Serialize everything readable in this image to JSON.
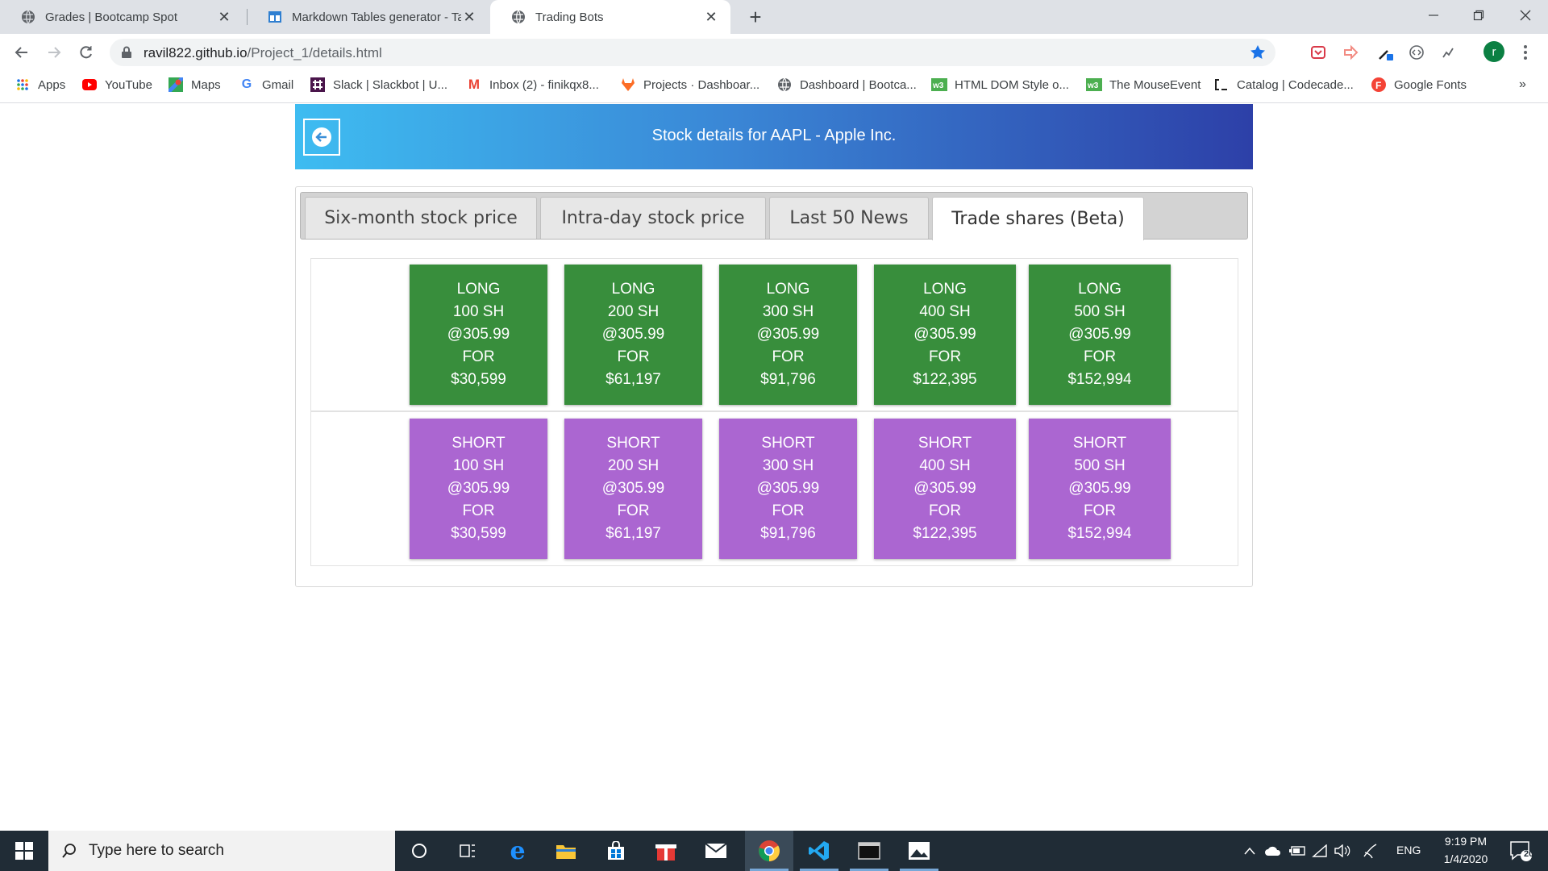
{
  "browser": {
    "tabs": [
      {
        "title": "Grades | Bootcamp Spot",
        "icon": "globe-icon",
        "active": false
      },
      {
        "title": "Markdown Tables generator - Tab",
        "icon": "tables-generator-icon",
        "active": false
      },
      {
        "title": "Trading Bots",
        "icon": "globe-icon",
        "active": true
      }
    ],
    "url_domain": "ravil822.github.io",
    "url_path": "/Project_1/details.html",
    "profile_initial": "r"
  },
  "bookmarks": [
    {
      "label": "Apps",
      "icon": "apps-grid-icon"
    },
    {
      "label": "YouTube",
      "icon": "youtube-icon"
    },
    {
      "label": "Maps",
      "icon": "maps-icon"
    },
    {
      "label": "Gmail",
      "icon": "google-icon"
    },
    {
      "label": "Slack | Slackbot | U...",
      "icon": "slack-icon"
    },
    {
      "label": "Inbox (2) - finikqx8...",
      "icon": "gmail-icon"
    },
    {
      "label": "Projects · Dashboar...",
      "icon": "gitlab-icon"
    },
    {
      "label": "Dashboard | Bootca...",
      "icon": "globe-icon"
    },
    {
      "label": "HTML DOM Style o...",
      "icon": "w3schools-icon"
    },
    {
      "label": "The MouseEvent",
      "icon": "w3schools-icon"
    },
    {
      "label": "Catalog | Codecade...",
      "icon": "codecademy-icon"
    },
    {
      "label": "Google Fonts",
      "icon": "google-fonts-icon"
    }
  ],
  "header": {
    "title": "Stock details for AAPL - Apple Inc."
  },
  "tabs": [
    {
      "label": "Six-month stock price",
      "active": false
    },
    {
      "label": "Intra-day stock price",
      "active": false
    },
    {
      "label": "Last 50 News",
      "active": false
    },
    {
      "label": "Trade shares (Beta)",
      "active": true
    }
  ],
  "trade": {
    "long": [
      {
        "side": "LONG",
        "shares": "100 SH",
        "price": "@305.99",
        "for": "FOR",
        "total": "$30,599"
      },
      {
        "side": "LONG",
        "shares": "200 SH",
        "price": "@305.99",
        "for": "FOR",
        "total": "$61,197"
      },
      {
        "side": "LONG",
        "shares": "300 SH",
        "price": "@305.99",
        "for": "FOR",
        "total": "$91,796"
      },
      {
        "side": "LONG",
        "shares": "400 SH",
        "price": "@305.99",
        "for": "FOR",
        "total": "$122,395"
      },
      {
        "side": "LONG",
        "shares": "500 SH",
        "price": "@305.99",
        "for": "FOR",
        "total": "$152,994"
      }
    ],
    "short": [
      {
        "side": "SHORT",
        "shares": "100 SH",
        "price": "@305.99",
        "for": "FOR",
        "total": "$30,599"
      },
      {
        "side": "SHORT",
        "shares": "200 SH",
        "price": "@305.99",
        "for": "FOR",
        "total": "$61,197"
      },
      {
        "side": "SHORT",
        "shares": "300 SH",
        "price": "@305.99",
        "for": "FOR",
        "total": "$91,796"
      },
      {
        "side": "SHORT",
        "shares": "400 SH",
        "price": "@305.99",
        "for": "FOR",
        "total": "$122,395"
      },
      {
        "side": "SHORT",
        "shares": "500 SH",
        "price": "@305.99",
        "for": "FOR",
        "total": "$152,994"
      }
    ]
  },
  "colors": {
    "long_button": "#388e3c",
    "short_button": "#ab66d1",
    "header_gradient_start": "#3ebcf1",
    "header_gradient_end": "#2d40a8"
  },
  "taskbar": {
    "search_placeholder": "Type here to search",
    "language": "ENG",
    "time": "9:19 PM",
    "date": "1/4/2020",
    "notification_count": "20"
  }
}
